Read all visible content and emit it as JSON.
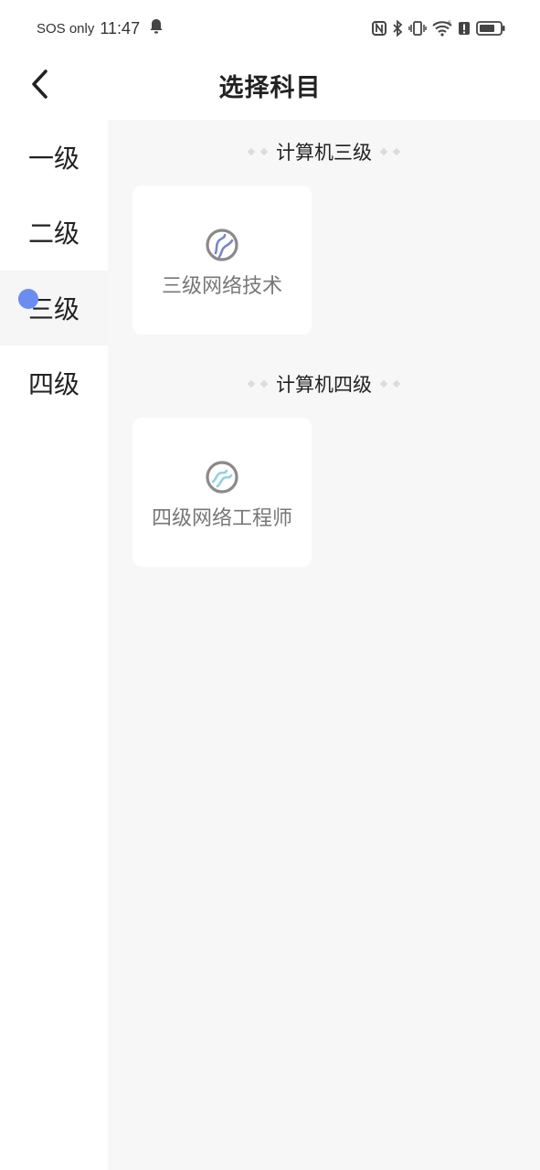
{
  "status_bar": {
    "carrier": "SOS only",
    "time": "11:47"
  },
  "header": {
    "title": "选择科目",
    "back_icon": "chevron-left-icon"
  },
  "sidebar": {
    "items": [
      {
        "label": "一级",
        "active": false
      },
      {
        "label": "二级",
        "active": false
      },
      {
        "label": "三级",
        "active": true
      },
      {
        "label": "四级",
        "active": false
      }
    ],
    "active_dot_color": "#6b8cf0"
  },
  "sections": [
    {
      "title": "计算机三级",
      "cards": [
        {
          "label": "三级网络技术",
          "icon": "globe-icon",
          "icon_accent": "#7a86c9"
        }
      ]
    },
    {
      "title": "计算机四级",
      "cards": [
        {
          "label": "四级网络工程师",
          "icon": "globe-icon",
          "icon_accent": "#8fd3e0"
        }
      ]
    }
  ],
  "colors": {
    "content_bg": "#f7f7f7",
    "card_bg": "#ffffff",
    "active_item_bg": "#f6f6f6"
  }
}
